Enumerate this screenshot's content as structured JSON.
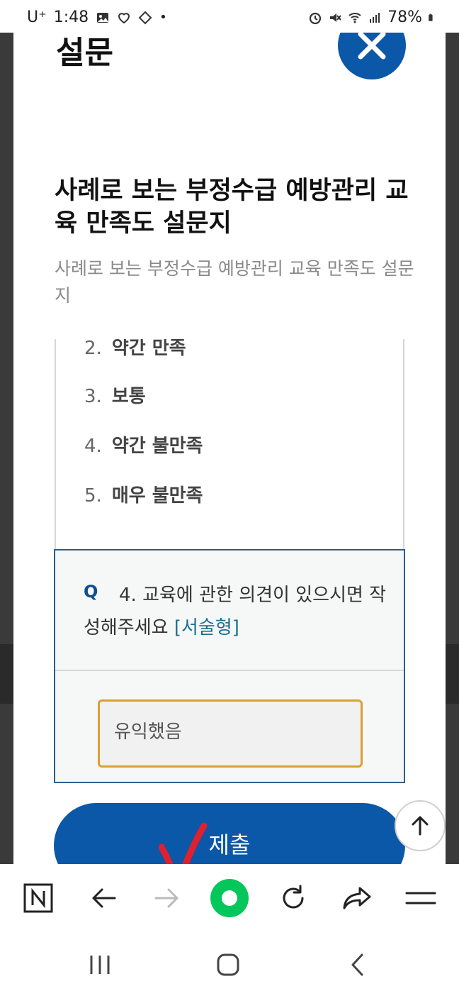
{
  "status": {
    "time": "1:48",
    "carrier": "U⁺",
    "battery": "78%"
  },
  "modal": {
    "heading_partial": "설문",
    "survey_title": "사례로 보는 부정수급 예방관리 교육 만족도 설문지",
    "survey_subtitle": "사례로 보는 부정수급 예방관리 교육 만족도 설문지",
    "options": [
      {
        "num": "2.",
        "label": "약간 만족"
      },
      {
        "num": "3.",
        "label": "보통"
      },
      {
        "num": "4.",
        "label": "약간 불만족"
      },
      {
        "num": "5.",
        "label": "매우 불만족"
      }
    ],
    "question": {
      "letter": "Q",
      "text": "4.  교육에 관한 의견이 있으시면 작성해주세요 ",
      "type": "[서술형]",
      "answer": "유익했음"
    },
    "submit_label": "제출"
  },
  "icons": {
    "close": "close-icon",
    "scroll_top": "arrow-up-icon",
    "toolbar": [
      "naver-n-icon",
      "back-arrow-icon",
      "forward-arrow-icon",
      "home-green-icon",
      "refresh-icon",
      "share-icon",
      "menu-icon"
    ],
    "sysnav": [
      "recent-apps-icon",
      "home-icon",
      "back-icon"
    ]
  },
  "colors": {
    "accent": "#0b57a8",
    "answer_border": "#d9a032",
    "annotation": "#e0202e",
    "home_button": "#03c75a"
  }
}
